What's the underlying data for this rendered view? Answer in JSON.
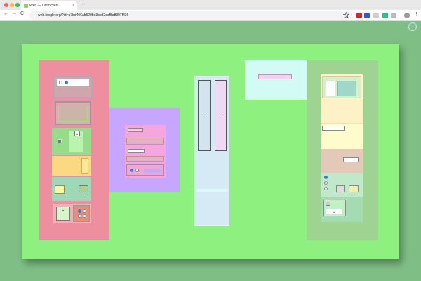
{
  "browser": {
    "tab_title": "Web — Dnhncyeo",
    "tab_close": "×",
    "new_tab": "+",
    "url": "web.leegle.org/?id=a7bd406ab520bd3bb32dcf5a8397f426",
    "nav_back": "←",
    "nav_forward": "→",
    "nav_reload": "C"
  },
  "colors": {
    "page_bg": "#7fbf86",
    "canvas": "#8ef07f",
    "pink_panel": "#ee8fa0",
    "purple_panel": "#c7a6ff",
    "blue_panel": "#d6eaf5",
    "cyan_panel": "#d3fbf6",
    "right_panel": "#9fd391"
  },
  "icons": {
    "star": "bookmark-star-icon",
    "corner": "chevron-circle-icon"
  },
  "widgets": {
    "select_chevron": "⌄"
  }
}
